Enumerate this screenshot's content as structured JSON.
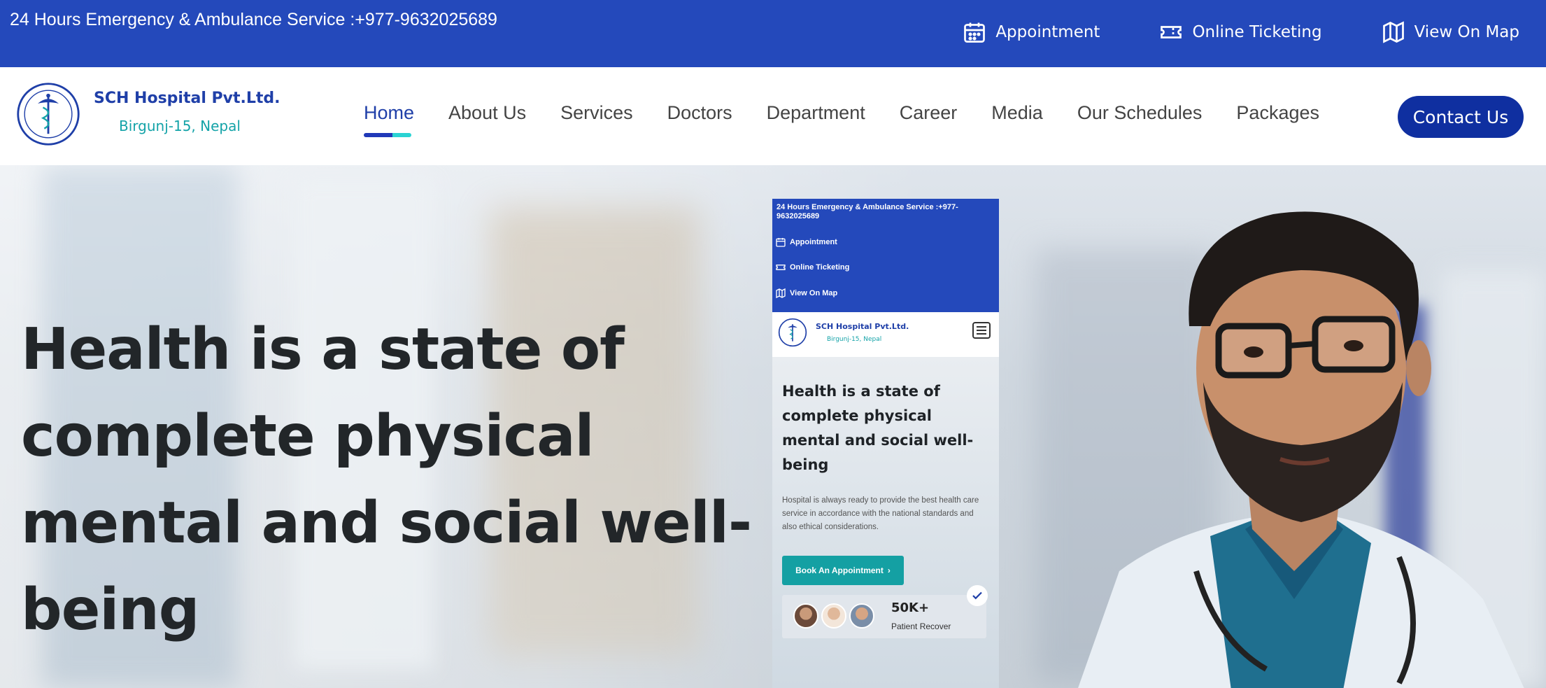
{
  "topbar": {
    "emergency": "24 Hours Emergency & Ambulance Service :+977-9632025689",
    "links": [
      {
        "label": "Appointment",
        "icon": "calendar-icon"
      },
      {
        "label": "Online Ticketing",
        "icon": "ticket-icon"
      },
      {
        "label": "View On Map",
        "icon": "map-icon"
      }
    ]
  },
  "brand": {
    "name": "SCH Hospital Pvt.Ltd.",
    "location": "Birgunj-15, Nepal"
  },
  "nav": {
    "items": [
      "Home",
      "About Us",
      "Services",
      "Doctors",
      "Department",
      "Career",
      "Media",
      "Our Schedules",
      "Packages"
    ],
    "active": "Home",
    "contact": "Contact Us"
  },
  "hero": {
    "title": "Health is a state of complete physical mental and social well-being"
  },
  "phone": {
    "emergency": "24 Hours Emergency & Ambulance Service :+977-9632025689",
    "links": [
      "Appointment",
      "Online Ticketing",
      "View On Map"
    ],
    "brand_name": "SCH Hospital Pvt.Ltd.",
    "brand_location": "Birgunj-15, Nepal",
    "title": "Health is a state of complete physical mental and social well-being",
    "description": "Hospital is always ready to provide the best health care service in accordance with the national standards and also ethical considerations.",
    "button": "Book An Appointment",
    "stat_value": "50K+",
    "stat_label": "Patient Recover"
  },
  "colors": {
    "topbar": "#2449bb",
    "brand": "#1f3fa8",
    "accent": "#14a3a8",
    "contact_button": "#0f2fa0"
  }
}
